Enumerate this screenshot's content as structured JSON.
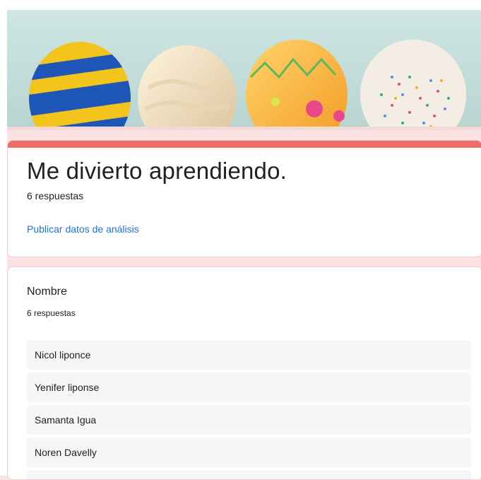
{
  "header": {
    "title": "Me divierto aprendiendo.",
    "responses": "6 respuestas",
    "publish_link": "Publicar datos de análisis"
  },
  "question": {
    "title": "Nombre",
    "responses": "6 respuestas",
    "answers": [
      "Nicol liponce",
      "Yenifer liponse",
      "Samanta Igua",
      "Noren Davelly",
      ""
    ]
  },
  "colors": {
    "accent": "#ee6f6a",
    "link": "#1a73e8",
    "page_background": "#fbe3e3"
  }
}
